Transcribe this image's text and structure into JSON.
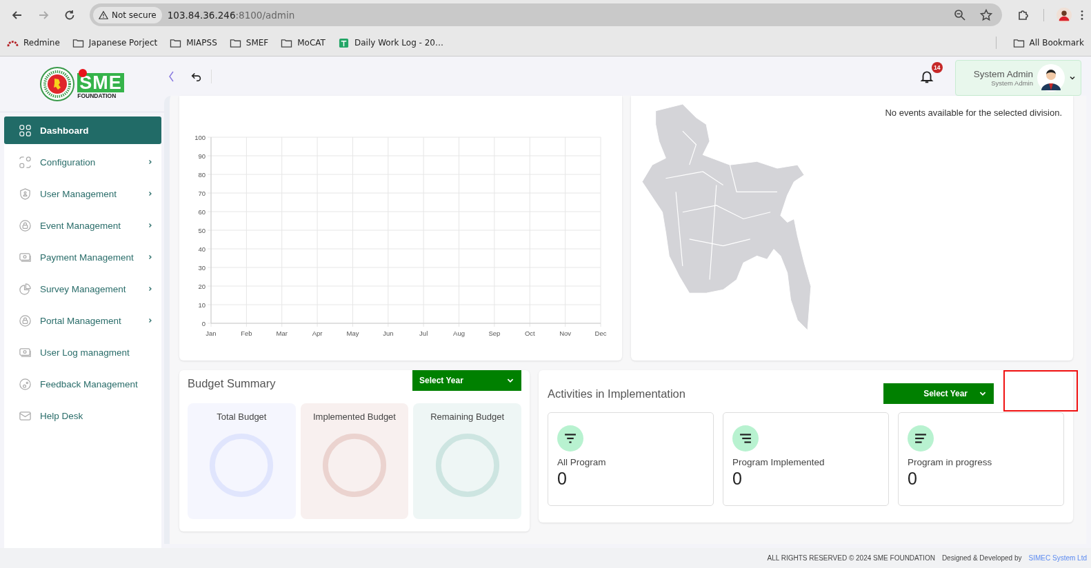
{
  "browser": {
    "security_label": "Not secure",
    "url_host": "103.84.36.246",
    "url_path": ":8100/admin",
    "bookmarks": [
      {
        "label": "Redmine",
        "kind": "redmine"
      },
      {
        "label": "Japanese Porject",
        "kind": "folder"
      },
      {
        "label": "MIAPSS",
        "kind": "folder"
      },
      {
        "label": "SMEF",
        "kind": "folder"
      },
      {
        "label": "MoCAT",
        "kind": "folder"
      },
      {
        "label": "Daily Work Log - 20…",
        "kind": "sheet"
      }
    ],
    "all_bookmarks": "All Bookmark"
  },
  "logo": {
    "wordmark": "SME",
    "tagline": "FOUNDATION"
  },
  "header": {
    "notification_count": "14",
    "user_name": "System Admin",
    "user_role": "System Admin"
  },
  "sidebar": {
    "items": [
      {
        "label": "Dashboard",
        "kind": "grid",
        "selected": true,
        "expandable": false
      },
      {
        "label": "Configuration",
        "kind": "config",
        "selected": false,
        "expandable": true
      },
      {
        "label": "User Management",
        "kind": "shield",
        "selected": false,
        "expandable": true
      },
      {
        "label": "Event Management",
        "kind": "lock",
        "selected": false,
        "expandable": true
      },
      {
        "label": "Payment Management",
        "kind": "money",
        "selected": false,
        "expandable": true
      },
      {
        "label": "Survey Management",
        "kind": "pie",
        "selected": false,
        "expandable": true
      },
      {
        "label": "Portal Management",
        "kind": "lock",
        "selected": false,
        "expandable": true
      },
      {
        "label": "User Log managment",
        "kind": "money",
        "selected": false,
        "expandable": false
      },
      {
        "label": "Feedback Management",
        "kind": "feedback",
        "selected": false,
        "expandable": false
      },
      {
        "label": "Help Desk",
        "kind": "mail",
        "selected": false,
        "expandable": false
      }
    ]
  },
  "chart_data": {
    "type": "line",
    "categories": [
      "Jan",
      "Feb",
      "Mar",
      "Apr",
      "May",
      "Jun",
      "Jul",
      "Aug",
      "Sep",
      "Oct",
      "Nov",
      "Dec"
    ],
    "grid": true,
    "ylim": [
      0,
      100
    ],
    "yticks": [
      0,
      10,
      20,
      30,
      40,
      50,
      60,
      70,
      80,
      90,
      100
    ]
  },
  "map": {
    "message": "No events available for the selected division."
  },
  "budget": {
    "title": "Budget Summary",
    "select": "Select Year",
    "cards": [
      {
        "label": "Total Budget",
        "color": "#e0e5fd"
      },
      {
        "label": "Implemented Budget",
        "color": "#ebd3cf"
      },
      {
        "label": "Remaining Budget",
        "color": "#cde5e1"
      }
    ]
  },
  "activities": {
    "title": "Activities in Implementation",
    "select": "Select Year",
    "stats": [
      {
        "label": "All Program",
        "value": "0",
        "kind": "center"
      },
      {
        "label": "Program Implemented",
        "value": "0",
        "kind": "right"
      },
      {
        "label": "Program in progress",
        "value": "0",
        "kind": "left"
      }
    ]
  },
  "footer": {
    "rights": "ALL RIGHTS RESERVED © 2024 SME FOUNDATION",
    "designed_by": "Designed & Developed by",
    "developer": "SIMEC System Ltd"
  }
}
